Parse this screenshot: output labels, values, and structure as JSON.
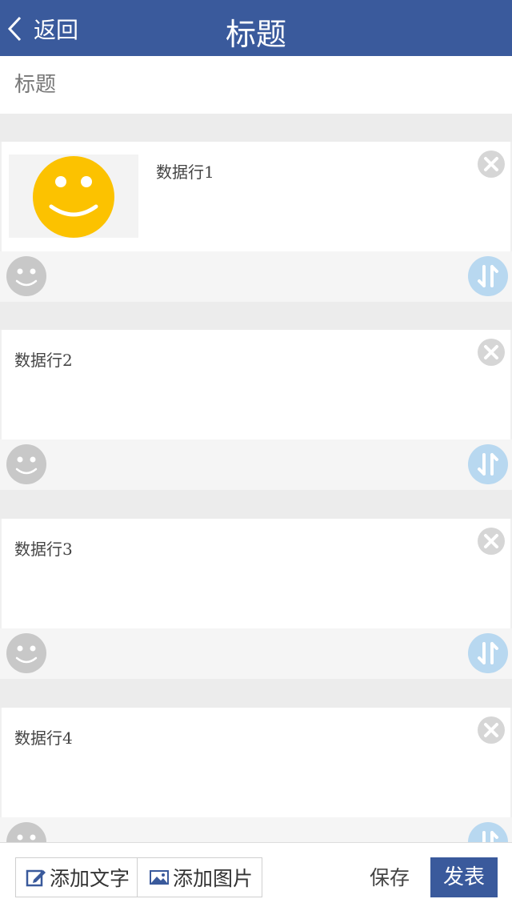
{
  "header": {
    "back_label": "返回",
    "title": "标题"
  },
  "title_field": {
    "placeholder": "标题",
    "value": ""
  },
  "blocks": [
    {
      "text": "数据行1",
      "has_image": true
    },
    {
      "text": "数据行2",
      "has_image": false
    },
    {
      "text": "数据行3",
      "has_image": false
    },
    {
      "text": "数据行4",
      "has_image": false
    }
  ],
  "footer": {
    "add_text_label": "添加文字",
    "add_image_label": "添加图片",
    "save_label": "保存",
    "publish_label": "发表"
  },
  "icons": {
    "back": "chevron-left-icon",
    "delete": "close-circle-icon",
    "emoji": "smiley-icon",
    "sort": "sort-arrows-icon",
    "add_text": "edit-icon",
    "add_image": "image-icon"
  },
  "colors": {
    "brand": "#3a5a9c",
    "background": "#ececec",
    "smiley_yellow": "#fcc200",
    "emoji_gray": "#c8c8c8",
    "sort_blue": "#b8d8f0",
    "delete_gray": "#d6d6d6"
  }
}
